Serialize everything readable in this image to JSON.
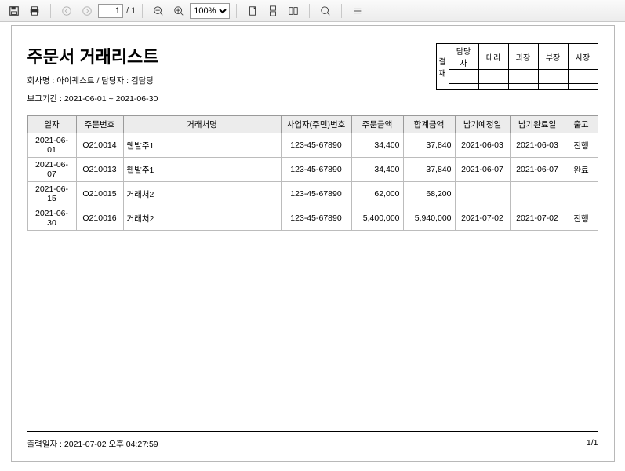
{
  "toolbar": {
    "page_current": "1",
    "page_total": "/ 1",
    "zoom": "100%"
  },
  "report": {
    "title": "주문서 거래리스트",
    "company_line": "회사명 : 아이퀘스트 / 담당자 : 김담당",
    "period_line": "보고기간 : 2021-06-01 ~ 2021-06-30",
    "print_line": "출력일자 : 2021-07-02 오후 04:27:59",
    "page_indicator": "1/1"
  },
  "approval": {
    "side_label": "결재",
    "cols": [
      "담당자",
      "대리",
      "과장",
      "부장",
      "사장"
    ]
  },
  "table": {
    "headers": [
      "일자",
      "주문번호",
      "거래처명",
      "사업자(주민)번호",
      "주문금액",
      "합계금액",
      "납기예정일",
      "납기완료일",
      "출고"
    ],
    "rows": [
      {
        "date": "2021-06-01",
        "no": "O210014",
        "client": "웹발주1",
        "biz": "123-45-67890",
        "order": "34,400",
        "total": "37,840",
        "due": "2021-06-03",
        "done": "2021-06-03",
        "ship": "진행"
      },
      {
        "date": "2021-06-07",
        "no": "O210013",
        "client": "웹발주1",
        "biz": "123-45-67890",
        "order": "34,400",
        "total": "37,840",
        "due": "2021-06-07",
        "done": "2021-06-07",
        "ship": "완료"
      },
      {
        "date": "2021-06-15",
        "no": "O210015",
        "client": "거래처2",
        "biz": "123-45-67890",
        "order": "62,000",
        "total": "68,200",
        "due": "",
        "done": "",
        "ship": ""
      },
      {
        "date": "2021-06-30",
        "no": "O210016",
        "client": "거래처2",
        "biz": "123-45-67890",
        "order": "5,400,000",
        "total": "5,940,000",
        "due": "2021-07-02",
        "done": "2021-07-02",
        "ship": "진행"
      }
    ]
  }
}
